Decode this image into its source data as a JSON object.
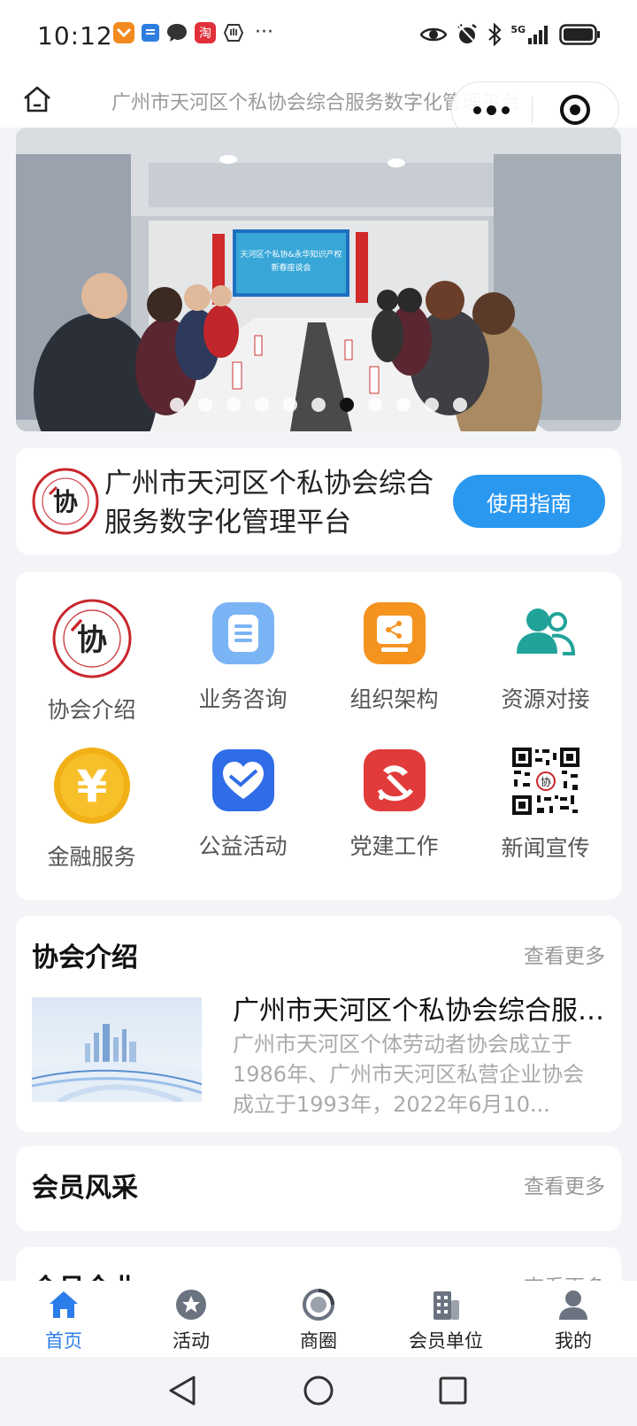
{
  "status_bar": {
    "time": "10:12",
    "app_icons": [
      "taobao-orange-icon",
      "blue-app-icon",
      "chat-bubble-icon",
      "taobao-icon",
      "shield-hand-icon"
    ],
    "taobao_glyph": "淘",
    "more": "···",
    "network": "5G"
  },
  "nav_bar": {
    "title": "广州市天河区个私协会综合服务数字化管理平台"
  },
  "banner": {
    "screen_text_line1": "天河区个私协&永华知识产权",
    "screen_text_line2": "新春座谈会",
    "slide_count": 11,
    "active_slide": 6
  },
  "header": {
    "title": "广州市天河区个私协会综合服务数字化管理平台",
    "guide_button": "使用指南",
    "logo_glyph": "协"
  },
  "menu": {
    "items": [
      {
        "label": "协会介绍",
        "icon": "association-logo-icon"
      },
      {
        "label": "业务咨询",
        "icon": "document-icon"
      },
      {
        "label": "组织架构",
        "icon": "share-screen-icon"
      },
      {
        "label": "资源对接",
        "icon": "users-icon"
      },
      {
        "label": "金融服务",
        "icon": "yuan-coin-icon"
      },
      {
        "label": "公益活动",
        "icon": "heart-icon"
      },
      {
        "label": "党建工作",
        "icon": "party-emblem-icon"
      },
      {
        "label": "新闻宣传",
        "icon": "qr-code-icon"
      }
    ],
    "coin_glyph": "¥"
  },
  "sections": {
    "intro": {
      "title": "协会介绍",
      "more": "查看更多",
      "article_title": "广州市天河区个私协会综合服务数字化管理平台",
      "article_text": "广州市天河区个体劳动者协会成立于1986年、广州市天河区私营企业协会成立于1993年，2022年6月10..."
    },
    "members_style": {
      "title": "会员风采",
      "more": "查看更多"
    },
    "member_companies": {
      "title": "会员企业",
      "more": "查看更多"
    }
  },
  "tab_bar": {
    "tabs": [
      {
        "label": "首页",
        "icon": "home-icon",
        "active": true
      },
      {
        "label": "活动",
        "icon": "star-badge-icon",
        "active": false
      },
      {
        "label": "商圈",
        "icon": "ring-icon",
        "active": false
      },
      {
        "label": "会员单位",
        "icon": "building-icon",
        "active": false
      },
      {
        "label": "我的",
        "icon": "profile-icon",
        "active": false
      }
    ]
  },
  "colors": {
    "accent": "#2b98f0",
    "tab_active": "#2b7de9",
    "background": "#f3f4f7"
  }
}
